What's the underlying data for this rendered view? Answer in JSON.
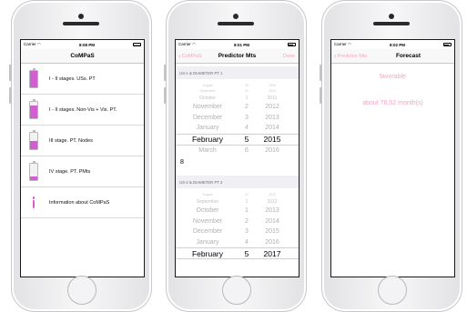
{
  "colors": {
    "accent": "#f5a3c4",
    "battery_fill": "#d05fd0",
    "status_battery_green": "#4cd964"
  },
  "screen1": {
    "status": {
      "carrier": "Carrier",
      "wifi_icon": "wifi-icon",
      "time": "8:08 PM"
    },
    "title": "CoMPaS",
    "items": [
      {
        "label": "I - II stages. USs. PT",
        "icon": "battery-icon",
        "level": 0.95
      },
      {
        "label": "I - II stages. Non-Vis + Vis. PT.",
        "icon": "battery-icon",
        "level": 0.75
      },
      {
        "label": "III stage. PT. Nodes",
        "icon": "battery-icon",
        "level": 0.5
      },
      {
        "label": "IV stage. PT. PMts",
        "icon": "battery-icon",
        "level": 0.2
      },
      {
        "label": "Information about CoMPaS",
        "icon": "info-icon"
      }
    ]
  },
  "screen2": {
    "status": {
      "carrier": "Carrier",
      "wifi_icon": "wifi-icon",
      "time": "8:01 PM"
    },
    "back_label": "CoMPaS",
    "title": "Predictor Mts",
    "done_label": "Done",
    "pickers": [
      {
        "header": "US-1 & DIAMETER PT 1",
        "rows": [
          {
            "month": "August",
            "day": "30",
            "year": "2009"
          },
          {
            "month": "September",
            "day": "31",
            "year": "2010"
          },
          {
            "month": "October",
            "day": "1",
            "year": "2011"
          },
          {
            "month": "November",
            "day": "2",
            "year": "2012"
          },
          {
            "month": "December",
            "day": "3",
            "year": "2013"
          },
          {
            "month": "January",
            "day": "4",
            "year": "2014"
          },
          {
            "month": "February",
            "day": "5",
            "year": "2015"
          },
          {
            "month": "March",
            "day": "6",
            "year": "2016"
          }
        ],
        "value": "8"
      },
      {
        "header": "US-2 & DIAMETER PT 2",
        "rows": [
          {
            "month": "August",
            "day": "31",
            "year": "2011"
          },
          {
            "month": "September",
            "day": "1",
            "year": "2012"
          },
          {
            "month": "October",
            "day": "1",
            "year": "2013"
          },
          {
            "month": "November",
            "day": "2",
            "year": "2014"
          },
          {
            "month": "December",
            "day": "3",
            "year": "2015"
          },
          {
            "month": "January",
            "day": "4",
            "year": "2016"
          },
          {
            "month": "February",
            "day": "5",
            "year": "2017"
          }
        ]
      }
    ]
  },
  "screen3": {
    "status": {
      "carrier": "Carrier",
      "wifi_icon": "wifi-icon",
      "time": "8:02 PM"
    },
    "back_label": "Predictor Mts",
    "title": "Forecast",
    "result_label": "favorable",
    "result_text": "about 76.52 month(s)"
  }
}
